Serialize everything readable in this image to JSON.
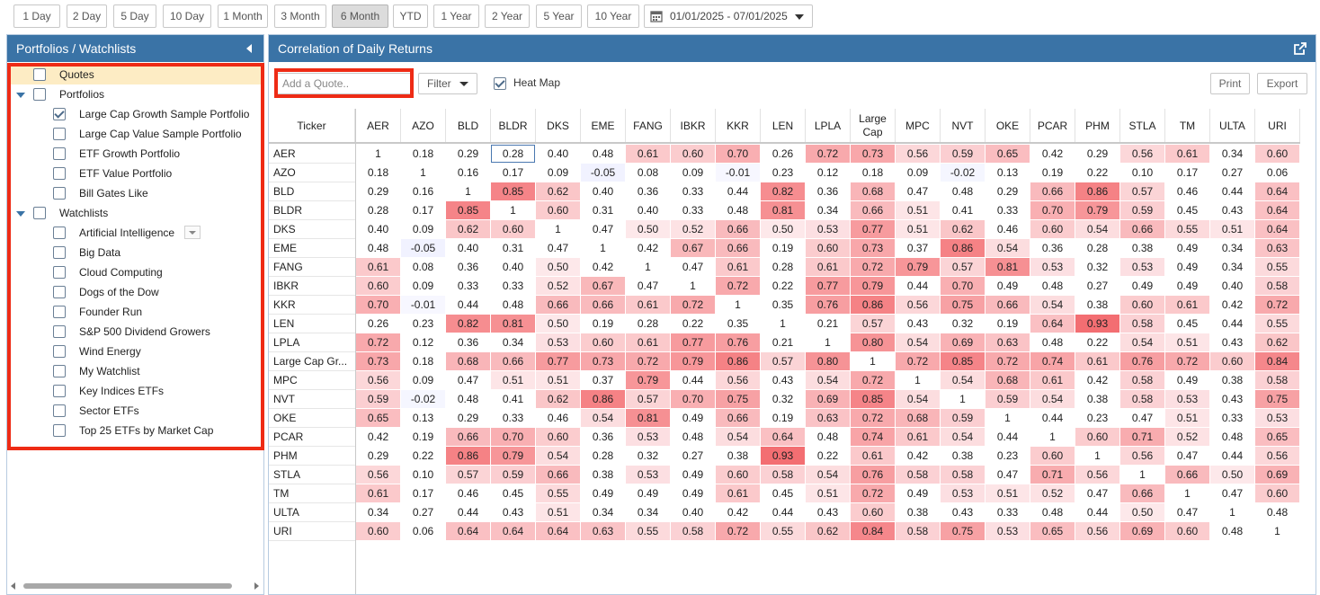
{
  "toolbar": {
    "ranges": [
      "1 Day",
      "2 Day",
      "5 Day",
      "10 Day",
      "1 Month",
      "3 Month",
      "6 Month",
      "YTD",
      "1 Year",
      "2 Year",
      "5 Year",
      "10 Year"
    ],
    "active_range": "6 Month",
    "date_range": "01/01/2025 - 07/01/2025"
  },
  "sidebar": {
    "title": "Portfolios / Watchlists",
    "quotes_label": "Quotes",
    "portfolios_label": "Portfolios",
    "portfolios": [
      {
        "label": "Large Cap Growth Sample Portfolio",
        "checked": true
      },
      {
        "label": "Large Cap Value Sample Portfolio",
        "checked": false
      },
      {
        "label": "ETF Growth Portfolio",
        "checked": false
      },
      {
        "label": "ETF Value Portfolio",
        "checked": false
      },
      {
        "label": "Bill Gates Like",
        "checked": false
      }
    ],
    "watchlists_label": "Watchlists",
    "watchlists": [
      "Artificial Intelligence",
      "Big Data",
      "Cloud Computing",
      "Dogs of the Dow",
      "Founder Run",
      "S&P 500 Dividend Growers",
      "Wind Energy",
      "My Watchlist",
      "Key Indices ETFs",
      "Sector ETFs",
      "Top 25 ETFs by Market Cap"
    ]
  },
  "main": {
    "title": "Correlation of Daily Returns",
    "quote_placeholder": "Add a Quote..",
    "filter_label": "Filter",
    "heatmap_label": "Heat Map",
    "heatmap_checked": true,
    "print_label": "Print",
    "export_label": "Export",
    "ticker_header": "Ticker",
    "columns": [
      "AER",
      "AZO",
      "BLD",
      "BLDR",
      "DKS",
      "EME",
      "FANG",
      "IBKR",
      "KKR",
      "LEN",
      "LPLA",
      "Large Cap",
      "MPC",
      "NVT",
      "OKE",
      "PCAR",
      "PHM",
      "STLA",
      "TM",
      "ULTA",
      "URI"
    ],
    "rows": [
      {
        "label": "AER",
        "values": [
          "1",
          "0.18",
          "0.29",
          "0.28",
          "0.40",
          "0.48",
          "0.61",
          "0.60",
          "0.70",
          "0.26",
          "0.72",
          "0.73",
          "0.56",
          "0.59",
          "0.65",
          "0.42",
          "0.29",
          "0.56",
          "0.61",
          "0.34",
          "0.60"
        ]
      },
      {
        "label": "AZO",
        "values": [
          "0.18",
          "1",
          "0.16",
          "0.17",
          "0.09",
          "-0.05",
          "0.08",
          "0.09",
          "-0.01",
          "0.23",
          "0.12",
          "0.18",
          "0.09",
          "-0.02",
          "0.13",
          "0.19",
          "0.22",
          "0.10",
          "0.17",
          "0.27",
          "0.06"
        ]
      },
      {
        "label": "BLD",
        "values": [
          "0.29",
          "0.16",
          "1",
          "0.85",
          "0.62",
          "0.40",
          "0.36",
          "0.33",
          "0.44",
          "0.82",
          "0.36",
          "0.68",
          "0.47",
          "0.48",
          "0.29",
          "0.66",
          "0.86",
          "0.57",
          "0.46",
          "0.44",
          "0.64"
        ]
      },
      {
        "label": "BLDR",
        "values": [
          "0.28",
          "0.17",
          "0.85",
          "1",
          "0.60",
          "0.31",
          "0.40",
          "0.33",
          "0.48",
          "0.81",
          "0.34",
          "0.66",
          "0.51",
          "0.41",
          "0.33",
          "0.70",
          "0.79",
          "0.59",
          "0.45",
          "0.43",
          "0.64"
        ]
      },
      {
        "label": "DKS",
        "values": [
          "0.40",
          "0.09",
          "0.62",
          "0.60",
          "1",
          "0.47",
          "0.50",
          "0.52",
          "0.66",
          "0.50",
          "0.53",
          "0.77",
          "0.51",
          "0.62",
          "0.46",
          "0.60",
          "0.54",
          "0.66",
          "0.55",
          "0.51",
          "0.64"
        ]
      },
      {
        "label": "EME",
        "values": [
          "0.48",
          "-0.05",
          "0.40",
          "0.31",
          "0.47",
          "1",
          "0.42",
          "0.67",
          "0.66",
          "0.19",
          "0.60",
          "0.73",
          "0.37",
          "0.86",
          "0.54",
          "0.36",
          "0.28",
          "0.38",
          "0.49",
          "0.34",
          "0.63"
        ]
      },
      {
        "label": "FANG",
        "values": [
          "0.61",
          "0.08",
          "0.36",
          "0.40",
          "0.50",
          "0.42",
          "1",
          "0.47",
          "0.61",
          "0.28",
          "0.61",
          "0.72",
          "0.79",
          "0.57",
          "0.81",
          "0.53",
          "0.32",
          "0.53",
          "0.49",
          "0.34",
          "0.55"
        ]
      },
      {
        "label": "IBKR",
        "values": [
          "0.60",
          "0.09",
          "0.33",
          "0.33",
          "0.52",
          "0.67",
          "0.47",
          "1",
          "0.72",
          "0.22",
          "0.77",
          "0.79",
          "0.44",
          "0.70",
          "0.49",
          "0.48",
          "0.27",
          "0.49",
          "0.49",
          "0.40",
          "0.58"
        ]
      },
      {
        "label": "KKR",
        "values": [
          "0.70",
          "-0.01",
          "0.44",
          "0.48",
          "0.66",
          "0.66",
          "0.61",
          "0.72",
          "1",
          "0.35",
          "0.76",
          "0.86",
          "0.56",
          "0.75",
          "0.66",
          "0.54",
          "0.38",
          "0.60",
          "0.61",
          "0.42",
          "0.72"
        ]
      },
      {
        "label": "LEN",
        "values": [
          "0.26",
          "0.23",
          "0.82",
          "0.81",
          "0.50",
          "0.19",
          "0.28",
          "0.22",
          "0.35",
          "1",
          "0.21",
          "0.57",
          "0.43",
          "0.32",
          "0.19",
          "0.64",
          "0.93",
          "0.58",
          "0.45",
          "0.44",
          "0.55"
        ]
      },
      {
        "label": "LPLA",
        "values": [
          "0.72",
          "0.12",
          "0.36",
          "0.34",
          "0.53",
          "0.60",
          "0.61",
          "0.77",
          "0.76",
          "0.21",
          "1",
          "0.80",
          "0.54",
          "0.69",
          "0.63",
          "0.48",
          "0.22",
          "0.54",
          "0.51",
          "0.43",
          "0.62"
        ]
      },
      {
        "label": "Large Cap Gr...",
        "values": [
          "0.73",
          "0.18",
          "0.68",
          "0.66",
          "0.77",
          "0.73",
          "0.72",
          "0.79",
          "0.86",
          "0.57",
          "0.80",
          "1",
          "0.72",
          "0.85",
          "0.72",
          "0.74",
          "0.61",
          "0.76",
          "0.72",
          "0.60",
          "0.84"
        ]
      },
      {
        "label": "MPC",
        "values": [
          "0.56",
          "0.09",
          "0.47",
          "0.51",
          "0.51",
          "0.37",
          "0.79",
          "0.44",
          "0.56",
          "0.43",
          "0.54",
          "0.72",
          "1",
          "0.54",
          "0.68",
          "0.61",
          "0.42",
          "0.58",
          "0.49",
          "0.38",
          "0.58"
        ]
      },
      {
        "label": "NVT",
        "values": [
          "0.59",
          "-0.02",
          "0.48",
          "0.41",
          "0.62",
          "0.86",
          "0.57",
          "0.70",
          "0.75",
          "0.32",
          "0.69",
          "0.85",
          "0.54",
          "1",
          "0.59",
          "0.54",
          "0.38",
          "0.58",
          "0.53",
          "0.43",
          "0.75"
        ]
      },
      {
        "label": "OKE",
        "values": [
          "0.65",
          "0.13",
          "0.29",
          "0.33",
          "0.46",
          "0.54",
          "0.81",
          "0.49",
          "0.66",
          "0.19",
          "0.63",
          "0.72",
          "0.68",
          "0.59",
          "1",
          "0.44",
          "0.23",
          "0.47",
          "0.51",
          "0.33",
          "0.53"
        ]
      },
      {
        "label": "PCAR",
        "values": [
          "0.42",
          "0.19",
          "0.66",
          "0.70",
          "0.60",
          "0.36",
          "0.53",
          "0.48",
          "0.54",
          "0.64",
          "0.48",
          "0.74",
          "0.61",
          "0.54",
          "0.44",
          "1",
          "0.60",
          "0.71",
          "0.52",
          "0.48",
          "0.65"
        ]
      },
      {
        "label": "PHM",
        "values": [
          "0.29",
          "0.22",
          "0.86",
          "0.79",
          "0.54",
          "0.28",
          "0.32",
          "0.27",
          "0.38",
          "0.93",
          "0.22",
          "0.61",
          "0.42",
          "0.38",
          "0.23",
          "0.60",
          "1",
          "0.56",
          "0.47",
          "0.44",
          "0.56"
        ]
      },
      {
        "label": "STLA",
        "values": [
          "0.56",
          "0.10",
          "0.57",
          "0.59",
          "0.66",
          "0.38",
          "0.53",
          "0.49",
          "0.60",
          "0.58",
          "0.54",
          "0.76",
          "0.58",
          "0.58",
          "0.47",
          "0.71",
          "0.56",
          "1",
          "0.66",
          "0.50",
          "0.69"
        ]
      },
      {
        "label": "TM",
        "values": [
          "0.61",
          "0.17",
          "0.46",
          "0.45",
          "0.55",
          "0.49",
          "0.49",
          "0.49",
          "0.61",
          "0.45",
          "0.51",
          "0.72",
          "0.49",
          "0.53",
          "0.51",
          "0.52",
          "0.47",
          "0.66",
          "1",
          "0.47",
          "0.60"
        ]
      },
      {
        "label": "ULTA",
        "values": [
          "0.34",
          "0.27",
          "0.44",
          "0.43",
          "0.51",
          "0.34",
          "0.34",
          "0.40",
          "0.42",
          "0.44",
          "0.43",
          "0.60",
          "0.38",
          "0.43",
          "0.33",
          "0.48",
          "0.44",
          "0.50",
          "0.47",
          "1",
          "0.48"
        ]
      },
      {
        "label": "URI",
        "values": [
          "0.60",
          "0.06",
          "0.64",
          "0.64",
          "0.64",
          "0.63",
          "0.55",
          "0.58",
          "0.72",
          "0.55",
          "0.62",
          "0.84",
          "0.58",
          "0.75",
          "0.53",
          "0.65",
          "0.56",
          "0.69",
          "0.60",
          "0.48",
          "1"
        ]
      }
    ],
    "focused_cell": {
      "row": 0,
      "col": 3
    }
  }
}
